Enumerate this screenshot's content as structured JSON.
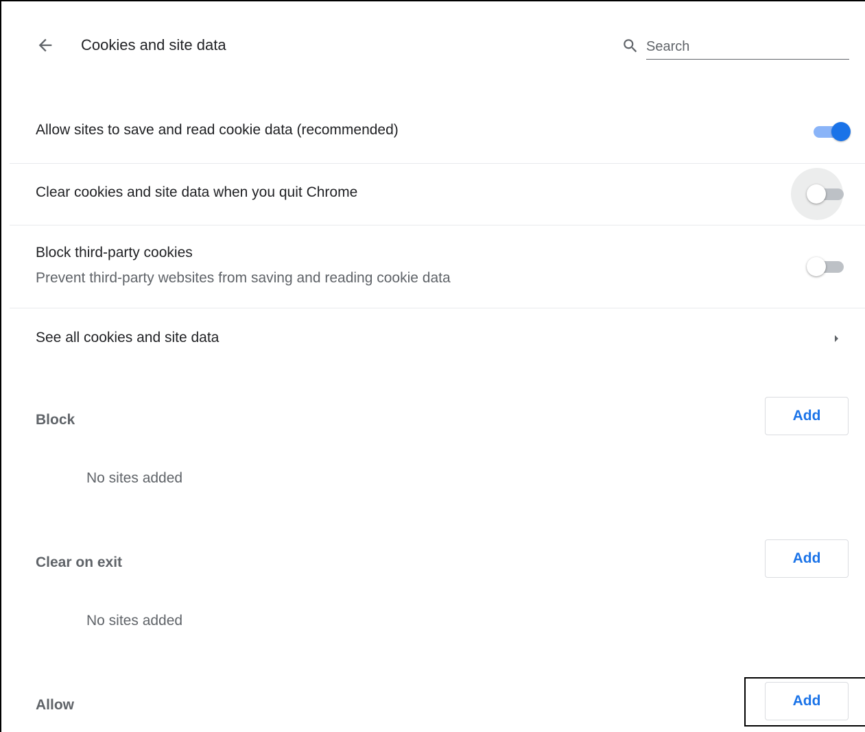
{
  "header": {
    "title": "Cookies and site data",
    "back_icon": "arrow-back-icon",
    "search": {
      "placeholder": "Search",
      "value": "",
      "icon": "search-icon"
    }
  },
  "settings": [
    {
      "label": "Allow sites to save and read cookie data (recommended)",
      "enabled": true
    },
    {
      "label": "Clear cookies and site data when you quit Chrome",
      "enabled": false
    },
    {
      "label": "Block third-party cookies",
      "sublabel": "Prevent third-party websites from saving and reading cookie data",
      "enabled": false
    }
  ],
  "see_all": {
    "label": "See all cookies and site data",
    "icon": "arrow-right-icon"
  },
  "sections": [
    {
      "title": "Block",
      "add_label": "Add",
      "empty_text": "No sites added"
    },
    {
      "title": "Clear on exit",
      "add_label": "Add",
      "empty_text": "No sites added"
    },
    {
      "title": "Allow",
      "add_label": "Add"
    }
  ],
  "colors": {
    "accent": "#1a73e8",
    "toggle_on_track": "#8ab4f8",
    "toggle_off_track": "#bdc1c6",
    "text_primary": "#202124",
    "text_secondary": "#5f6368",
    "divider": "#e8eaed"
  }
}
